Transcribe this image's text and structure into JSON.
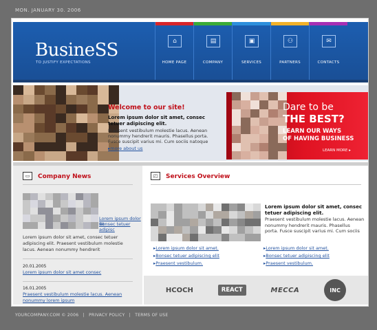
{
  "top_date": "MON. JANUARY 30. 2006",
  "header": {
    "brand": "BusineSS",
    "tagline": "TO JUSTIFY EXPECTATIONS",
    "nav": [
      {
        "label": "HOME PAGE",
        "icon": "home-icon",
        "glyph": "⌂",
        "color": "#d7262a"
      },
      {
        "label": "COMPANY",
        "icon": "document-icon",
        "glyph": "▤",
        "color": "#3bab37"
      },
      {
        "label": "SERVICES",
        "icon": "briefcase-icon",
        "glyph": "▣",
        "color": "#2d8fdc"
      },
      {
        "label": "PARTNERS",
        "icon": "partners-icon",
        "glyph": "⚇",
        "color": "#f1b12a"
      },
      {
        "label": "CONTACTS",
        "icon": "mail-icon",
        "glyph": "✉",
        "color": "#a72fb4"
      }
    ]
  },
  "hero": {
    "welcome_title": "Welcome to our site!",
    "lead": "Lorem ipsum dolor sit amet, consec tetuer adipiscing elit.",
    "body": "Praesent vestibulum molestie lacus. Aenean nonummy hendrerit mauris. Phasellus porta. Fusce suscipit varius mi. Cum sociis natoque",
    "more": "more about us"
  },
  "promo": {
    "q1": "Dare to be",
    "q2": "THE BEST?",
    "s1": "LEARN OUR WAYS",
    "s2": "OF HAVING BUSINESS",
    "more": "LEARN MORE"
  },
  "news": {
    "title": "Company News",
    "link_a": "Lorem ipsum dolor sit",
    "link_b": "Bonsec tetuer adipisc",
    "body": "Lorem ipsum dolor sit amet, consec tetuer adipiscing elit. Praesent vestibulum molestie lacus. Aenean nonummy hendrerit",
    "items": [
      {
        "date": "20.01.2005",
        "link": "Lorem ipsum dolor sit amet consec"
      },
      {
        "date": "16.01.2005",
        "link": "Praesent vestibulum molestie lacus. Aenean nonummy lorem ipsum"
      }
    ]
  },
  "services": {
    "title": "Services Overview",
    "lead": "Lorem ipsum dolor sit amet, consec tetuer adipiscing elit.",
    "body": "Praesent vestibulum molestie lacus. Aenean nonummy hendrerit mauris. Phasellus porta. Fusce suscipit varius mi. Cum sociis",
    "list_left": [
      "Lorem ipsum dolor sit amet.",
      "Bonsec tetuer adipiscing elit",
      "Praesent vestibulum."
    ],
    "list_right": [
      "Lorem ipsum dolor sit amet.",
      "Bonsec tetuer adipiscing elit",
      "Praesent vestibulum."
    ],
    "logos": [
      "HCOCH",
      "REACT",
      "MECCA",
      "INC"
    ]
  },
  "footer": {
    "copyright": "YOURCOMPANY.COM © 2006",
    "privacy": "PRIVACY POLICY",
    "terms": "TERMS OF USE"
  }
}
